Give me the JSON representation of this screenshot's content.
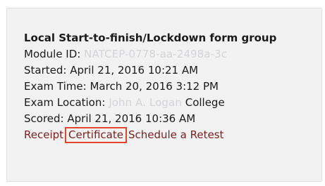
{
  "exam": {
    "title": "Local Start-to-finish/Lockdown form group",
    "module_id_label": "Module ID:",
    "module_id_value": "NATCEP-0778-aa-2498a-3c",
    "started_label": "Started:",
    "started_value": "April 21, 2016 10:21 AM",
    "exam_time_label": "Exam Time:",
    "exam_time_value": "March 20, 2016 3:12 PM",
    "location_label": "Exam Location:",
    "location_value_blurred": "John A. Logan",
    "location_value_visible": "College",
    "scored_label": "Scored:",
    "scored_value": "April 21, 2016 10:36 AM"
  },
  "actions": {
    "receipt_label": "Receipt",
    "certificate_label": "Certificate",
    "schedule_retest_label": "Schedule a Retest"
  },
  "colors": {
    "card_background": "#f2f2f2",
    "link_color": "#7a1f1f",
    "highlight_border": "#e3462b"
  }
}
